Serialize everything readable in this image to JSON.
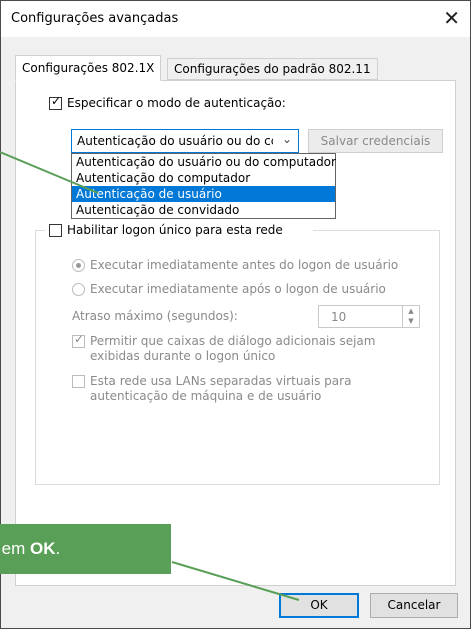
{
  "window": {
    "title": "Configurações avançadas",
    "close_icon": "close-icon"
  },
  "tabs": [
    {
      "label": "Configurações 802.1X",
      "active": true
    },
    {
      "label": "Configurações do padrão 802.11",
      "active": false
    }
  ],
  "auth": {
    "specify_label": "Especificar o modo de autenticação:",
    "specify_checked": true,
    "selected_value": "Autenticação do usuário ou do cc",
    "save_credentials": "Salvar credenciais",
    "options": [
      "Autenticação do usuário ou do computador",
      "Autenticação do computador",
      "Autenticação de usuário",
      "Autenticação de convidado"
    ],
    "highlighted_index": 2
  },
  "sso": {
    "enable_label": "Habilitar logon único para esta rede",
    "enable_checked": false,
    "radio_before": "Executar imediatamente antes do logon de usuário",
    "radio_after": "Executar imediatamente após o logon de usuário",
    "max_delay_label": "Atraso máximo (segundos):",
    "max_delay_value": "10",
    "allow_dialogs_line1": "Permitir que caixas de diálogo adicionais sejam",
    "allow_dialogs_line2": "exibidas durante o logon único",
    "allow_dialogs_checked": true,
    "vlan_line1": "Esta rede usa LANs separadas virtuais para",
    "vlan_line2": "autenticação de máquina e de usuário",
    "vlan_checked": false
  },
  "buttons": {
    "ok": "OK",
    "cancel": "Cancelar"
  },
  "callout": {
    "prefix": "ue em ",
    "bold": "OK",
    "suffix": ".",
    "color": "#5a9f57"
  },
  "colors": {
    "accent": "#0078d7",
    "callout": "#5a9f57"
  }
}
